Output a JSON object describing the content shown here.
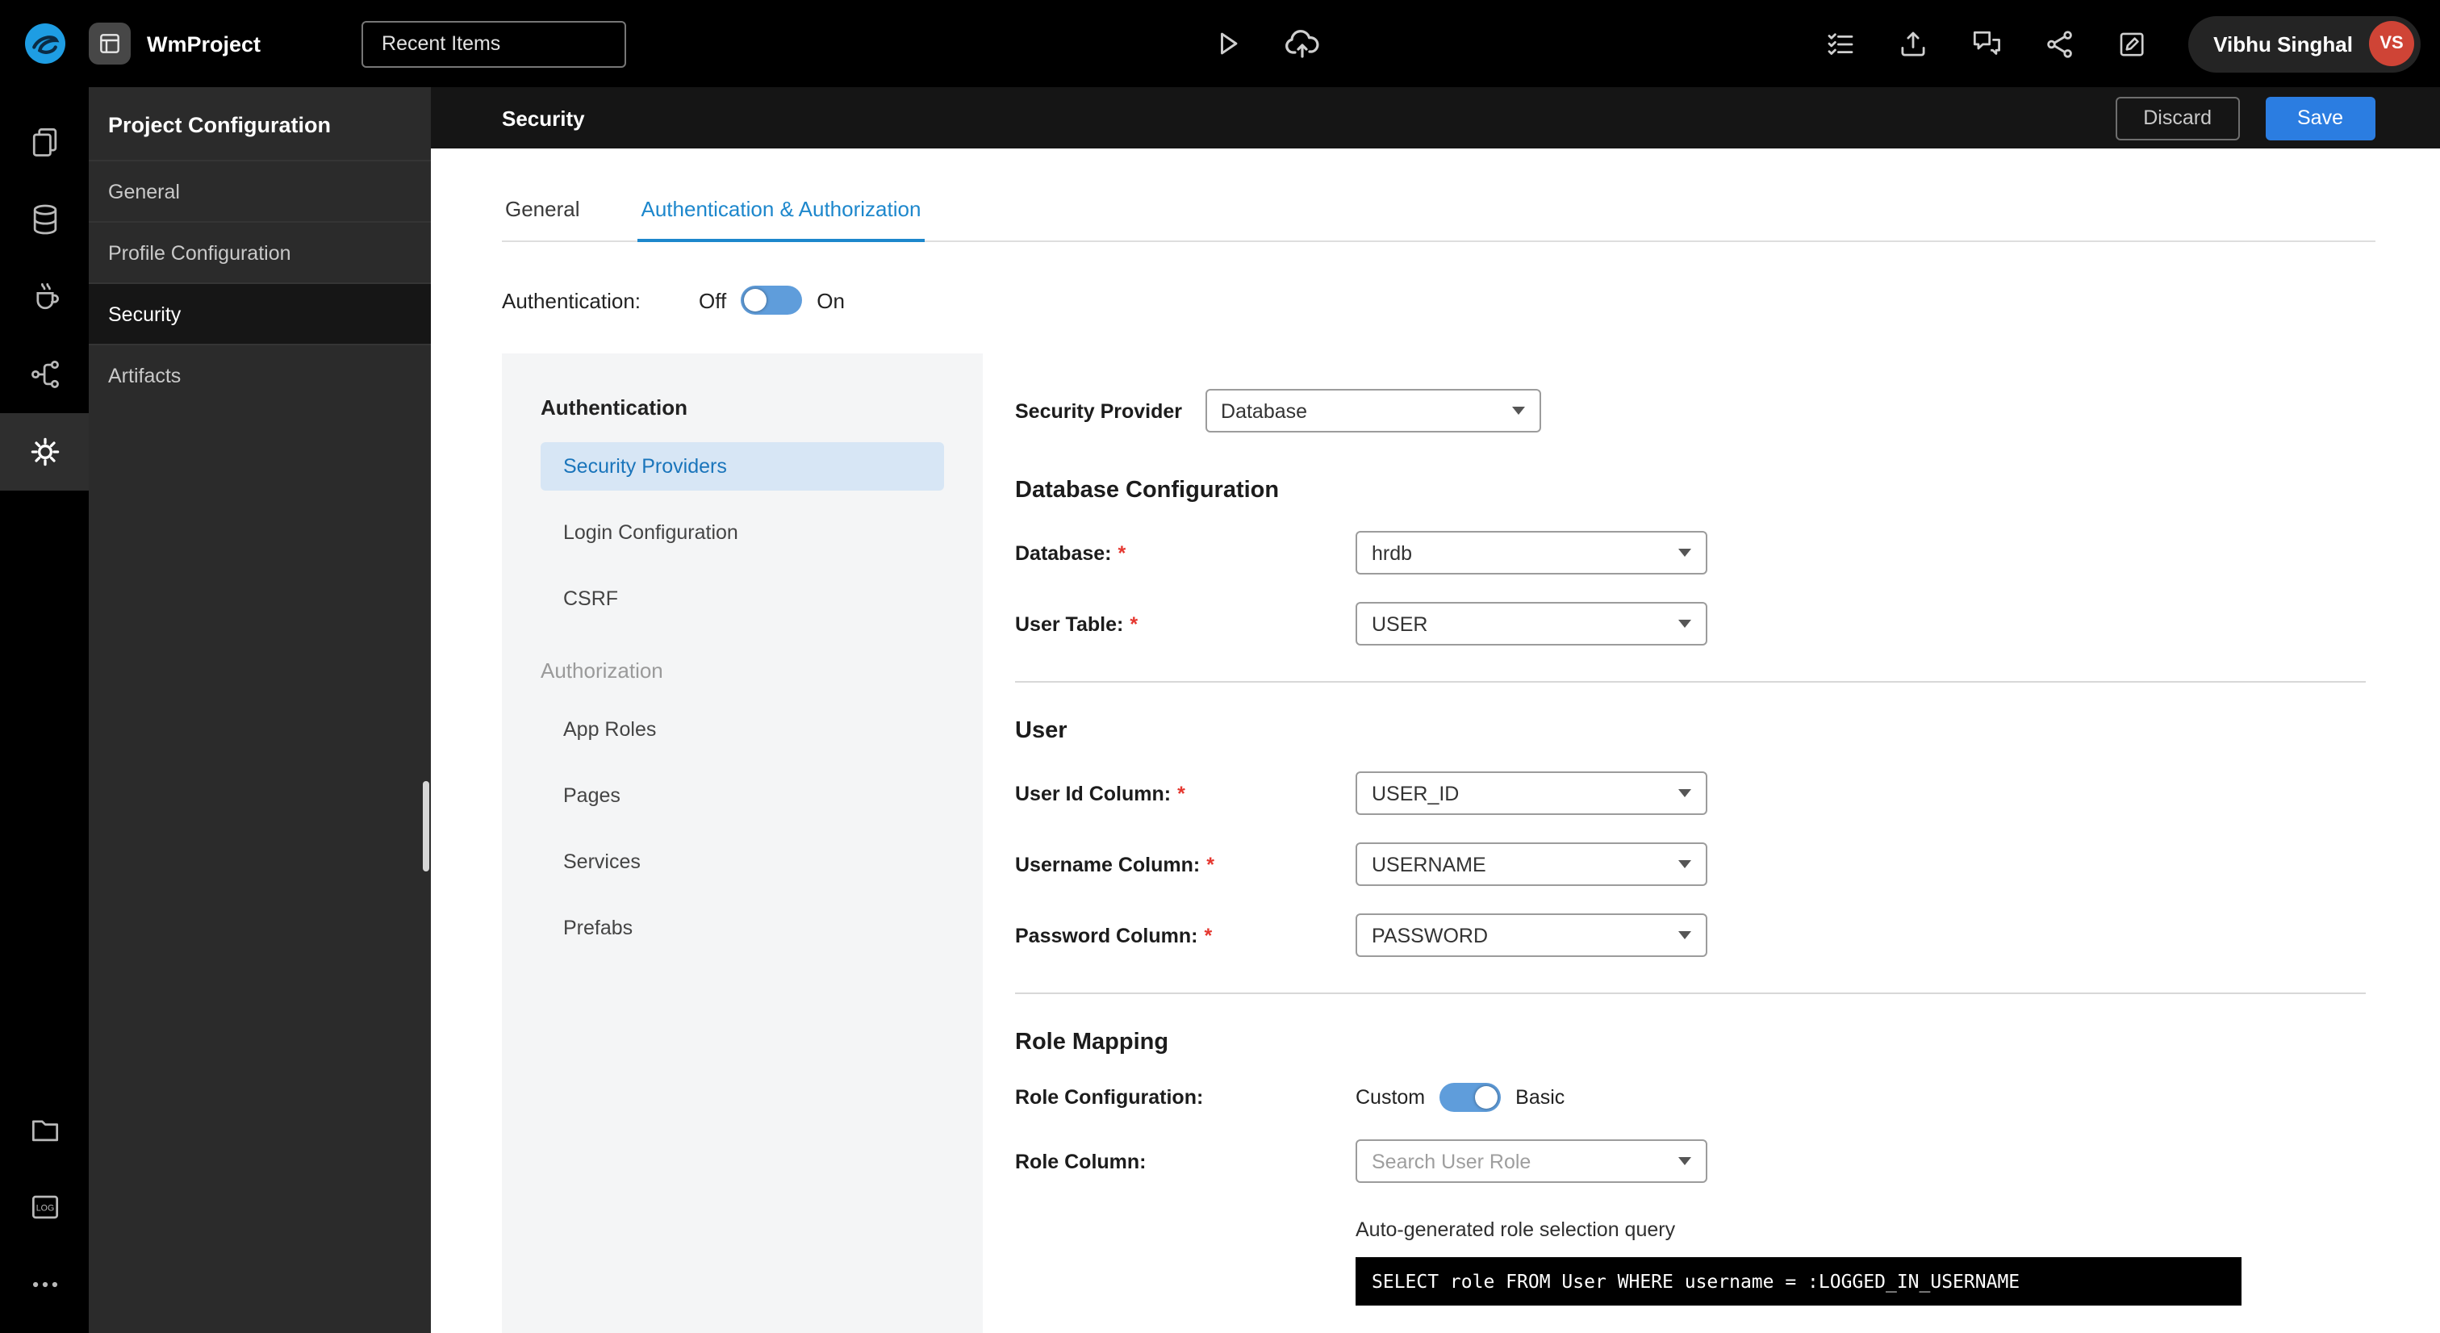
{
  "ui": {
    "required_marker": "*"
  },
  "colors": {
    "accent_blue": "#2b7de1",
    "tab_blue": "#1d87cc",
    "toggle_blue": "#5f9ddb",
    "subnav_selected_bg": "#d7e6f5",
    "avatar_red": "#cf4436",
    "code_bg": "#000000"
  },
  "topbar": {
    "app_name": "WmProject",
    "recent_items_label": "Recent Items",
    "user_name": "Vibhu Singhal",
    "user_initials": "VS",
    "center_icons": [
      "run-icon",
      "deploy-icon"
    ],
    "right_icons": [
      "checklist-icon",
      "export-icon",
      "chat-icon",
      "share-icon",
      "feedback-icon"
    ]
  },
  "rail": {
    "top_icons": [
      "pages-icon",
      "database-icon",
      "java-services-icon",
      "apis-icon",
      "settings-icon"
    ],
    "bottom_icons": [
      "files-icon",
      "logs-icon",
      "more-icon"
    ],
    "selected": "settings-icon"
  },
  "sidebar": {
    "title": "Project Configuration",
    "items": [
      {
        "label": "General",
        "selected": false
      },
      {
        "label": "Profile Configuration",
        "selected": false
      },
      {
        "label": "Security",
        "selected": true
      },
      {
        "label": "Artifacts",
        "selected": false
      }
    ]
  },
  "header": {
    "title": "Security",
    "discard_label": "Discard",
    "save_label": "Save"
  },
  "tabs": [
    {
      "label": "General",
      "active": false
    },
    {
      "label": "Authentication & Authorization",
      "active": true
    }
  ],
  "auth_toggle": {
    "label": "Authentication:",
    "off_label": "Off",
    "on_label": "On",
    "state": "on"
  },
  "subnav": {
    "sections": [
      {
        "title": "Authentication",
        "items": [
          "Security Providers",
          "Login Configuration",
          "CSRF"
        ],
        "selected_item": "Security Providers"
      },
      {
        "title": "Authorization",
        "items": [
          "App Roles",
          "Pages",
          "Services",
          "Prefabs"
        ]
      }
    ]
  },
  "form": {
    "security_provider_label": "Security Provider",
    "security_provider_value": "Database",
    "database_config_title": "Database Configuration",
    "database_label": "Database:",
    "database_value": "hrdb",
    "user_table_label": "User Table:",
    "user_table_value": "USER",
    "user_section_title": "User",
    "user_id_label": "User Id Column:",
    "user_id_value": "USER_ID",
    "username_label": "Username Column:",
    "username_value": "USERNAME",
    "password_label": "Password Column:",
    "password_value": "PASSWORD",
    "role_section_title": "Role Mapping",
    "role_config_label": "Role Configuration:",
    "role_custom_label": "Custom",
    "role_basic_label": "Basic",
    "role_column_label": "Role Column:",
    "role_column_placeholder": "Search User Role",
    "query_caption": "Auto-generated role selection query",
    "query_text": "SELECT role FROM User WHERE username = :LOGGED_IN_USERNAME"
  }
}
